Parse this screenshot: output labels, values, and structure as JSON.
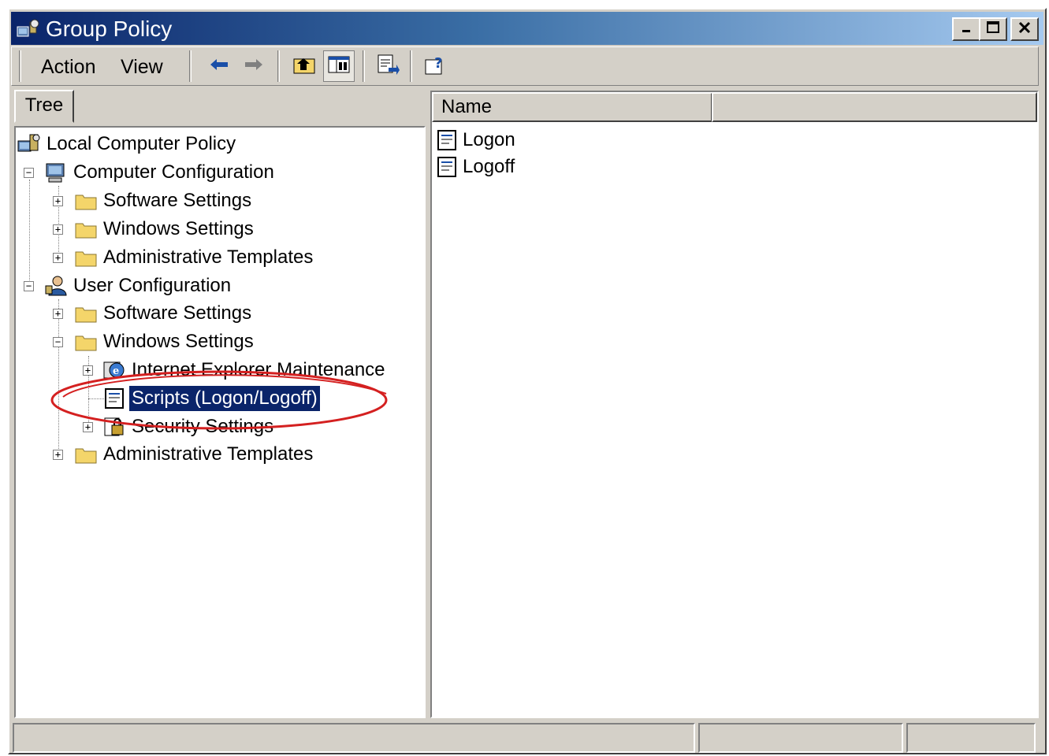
{
  "window": {
    "title": "Group Policy"
  },
  "menu": {
    "action_label": "Action",
    "view_label": "View"
  },
  "toolbar": {
    "buttons": [
      "back-arrow-icon",
      "forward-arrow-icon",
      "up-folder-icon",
      "show-hide-tree-icon",
      "export-list-icon",
      "help-icon"
    ]
  },
  "tabs": {
    "tree_label": "Tree"
  },
  "tree": {
    "root": "Local Computer Policy",
    "computer": "Computer Configuration",
    "computer_software": "Software Settings",
    "computer_windows": "Windows Settings",
    "computer_admin": "Administrative Templates",
    "user": "User Configuration",
    "user_software": "Software Settings",
    "user_windows": "Windows Settings",
    "user_ie": "Internet Explorer Maintenance",
    "user_scripts": "Scripts (Logon/Logoff)",
    "user_security": "Security Settings",
    "user_admin": "Administrative Templates"
  },
  "list": {
    "column_name": "Name",
    "items": [
      "Logon",
      "Logoff"
    ]
  },
  "colors": {
    "title_start": "#0a246a",
    "title_end": "#a6caf0",
    "selection": "#0a246a",
    "annotation": "#d42020",
    "folder": "#f4d56a"
  }
}
